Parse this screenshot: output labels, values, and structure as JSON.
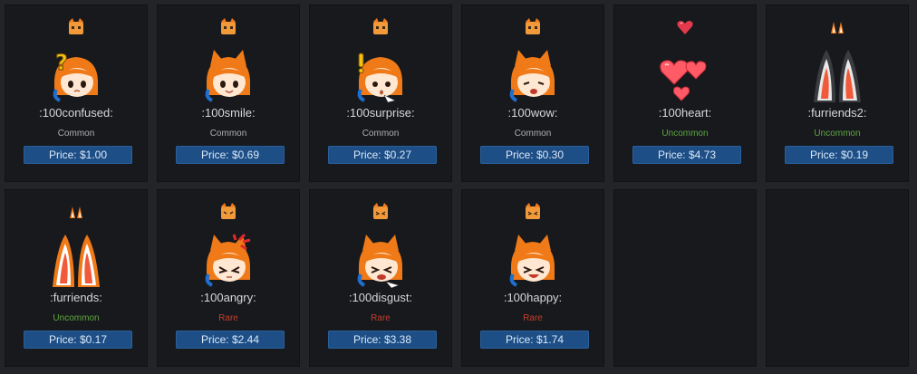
{
  "colors": {
    "background": "#232428",
    "card": "#17191d",
    "price_button": "#1d4e86",
    "common": "#b0b0b0",
    "uncommon": "#5fa83f",
    "rare": "#c63e2b"
  },
  "items": [
    {
      "name": ":100confused:",
      "rarity": "Common",
      "rarity_class": "common",
      "price": "Price: $1.00",
      "icon": "confused-face-icon"
    },
    {
      "name": ":100smile:",
      "rarity": "Common",
      "rarity_class": "common",
      "price": "Price: $0.69",
      "icon": "smile-face-icon"
    },
    {
      "name": ":100surprise:",
      "rarity": "Common",
      "rarity_class": "common",
      "price": "Price: $0.27",
      "icon": "surprise-face-icon"
    },
    {
      "name": ":100wow:",
      "rarity": "Common",
      "rarity_class": "common",
      "price": "Price: $0.30",
      "icon": "wow-face-icon"
    },
    {
      "name": ":100heart:",
      "rarity": "Uncommon",
      "rarity_class": "uncommon",
      "price": "Price: $4.73",
      "icon": "hearts-icon"
    },
    {
      "name": ":furriends2:",
      "rarity": "Uncommon",
      "rarity_class": "uncommon",
      "price": "Price: $0.19",
      "icon": "fox-ears-icon"
    },
    {
      "name": ":furriends:",
      "rarity": "Uncommon",
      "rarity_class": "uncommon",
      "price": "Price: $0.17",
      "icon": "fox-ears-icon"
    },
    {
      "name": ":100angry:",
      "rarity": "Rare",
      "rarity_class": "rare",
      "price": "Price: $2.44",
      "icon": "angry-face-icon"
    },
    {
      "name": ":100disgust:",
      "rarity": "Rare",
      "rarity_class": "rare",
      "price": "Price: $3.38",
      "icon": "disgust-face-icon"
    },
    {
      "name": ":100happy:",
      "rarity": "Rare",
      "rarity_class": "rare",
      "price": "Price: $1.74",
      "icon": "happy-face-icon"
    }
  ]
}
